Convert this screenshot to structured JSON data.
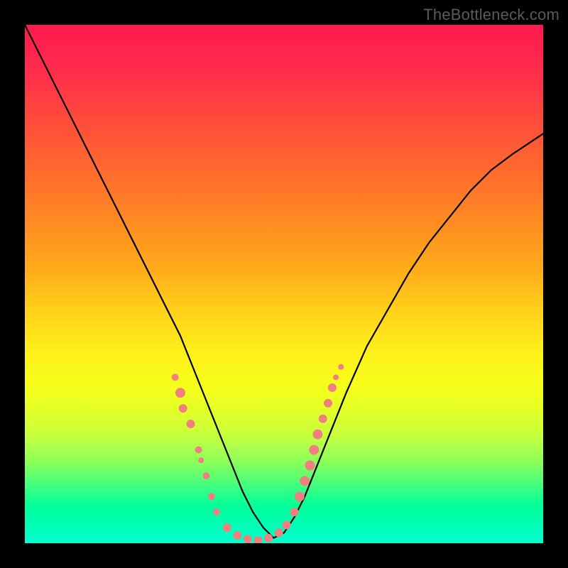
{
  "watermark": "TheBottleneck.com",
  "chart_data": {
    "type": "line",
    "title": "",
    "xlabel": "",
    "ylabel": "",
    "xlim": [
      0,
      100
    ],
    "ylim": [
      0,
      100
    ],
    "grid": false,
    "series": [
      {
        "name": "curve",
        "color": "#000000",
        "x": [
          0,
          3,
          6,
          9,
          12,
          15,
          18,
          21,
          24,
          27,
          30,
          32,
          34,
          36,
          38,
          40,
          42,
          44,
          46,
          48,
          50,
          52,
          54,
          56,
          58,
          60,
          62,
          66,
          70,
          74,
          78,
          82,
          86,
          90,
          94,
          100
        ],
        "y": [
          100,
          94,
          88,
          82,
          76,
          70,
          64,
          58,
          52,
          46,
          40,
          35,
          30,
          25,
          20,
          15,
          10,
          6,
          3,
          1,
          2,
          5,
          9,
          14,
          19,
          24,
          29,
          38,
          45,
          52,
          58,
          63,
          68,
          72,
          75,
          79
        ]
      }
    ],
    "scatter": {
      "color": "#f08080",
      "points": [
        {
          "x": 29,
          "y": 32,
          "r": 5
        },
        {
          "x": 30,
          "y": 29,
          "r": 7
        },
        {
          "x": 30.5,
          "y": 26,
          "r": 6
        },
        {
          "x": 32,
          "y": 23,
          "r": 6
        },
        {
          "x": 33.5,
          "y": 18,
          "r": 5
        },
        {
          "x": 34,
          "y": 16,
          "r": 4
        },
        {
          "x": 35,
          "y": 13,
          "r": 5
        },
        {
          "x": 36,
          "y": 9,
          "r": 5
        },
        {
          "x": 37,
          "y": 6,
          "r": 5
        },
        {
          "x": 39,
          "y": 3,
          "r": 6
        },
        {
          "x": 41,
          "y": 1.5,
          "r": 6
        },
        {
          "x": 43,
          "y": 0.8,
          "r": 6
        },
        {
          "x": 45,
          "y": 0.5,
          "r": 6
        },
        {
          "x": 47,
          "y": 1,
          "r": 6
        },
        {
          "x": 49,
          "y": 2,
          "r": 6
        },
        {
          "x": 50.5,
          "y": 3.5,
          "r": 6
        },
        {
          "x": 52,
          "y": 6,
          "r": 6
        },
        {
          "x": 53,
          "y": 9,
          "r": 7
        },
        {
          "x": 54,
          "y": 12,
          "r": 7
        },
        {
          "x": 55,
          "y": 15,
          "r": 7
        },
        {
          "x": 55.8,
          "y": 18,
          "r": 7
        },
        {
          "x": 56.5,
          "y": 21,
          "r": 7
        },
        {
          "x": 57.5,
          "y": 24,
          "r": 6
        },
        {
          "x": 58.5,
          "y": 27,
          "r": 6
        },
        {
          "x": 59.3,
          "y": 30,
          "r": 6
        },
        {
          "x": 60,
          "y": 32,
          "r": 4
        },
        {
          "x": 61,
          "y": 34,
          "r": 4
        }
      ]
    }
  }
}
